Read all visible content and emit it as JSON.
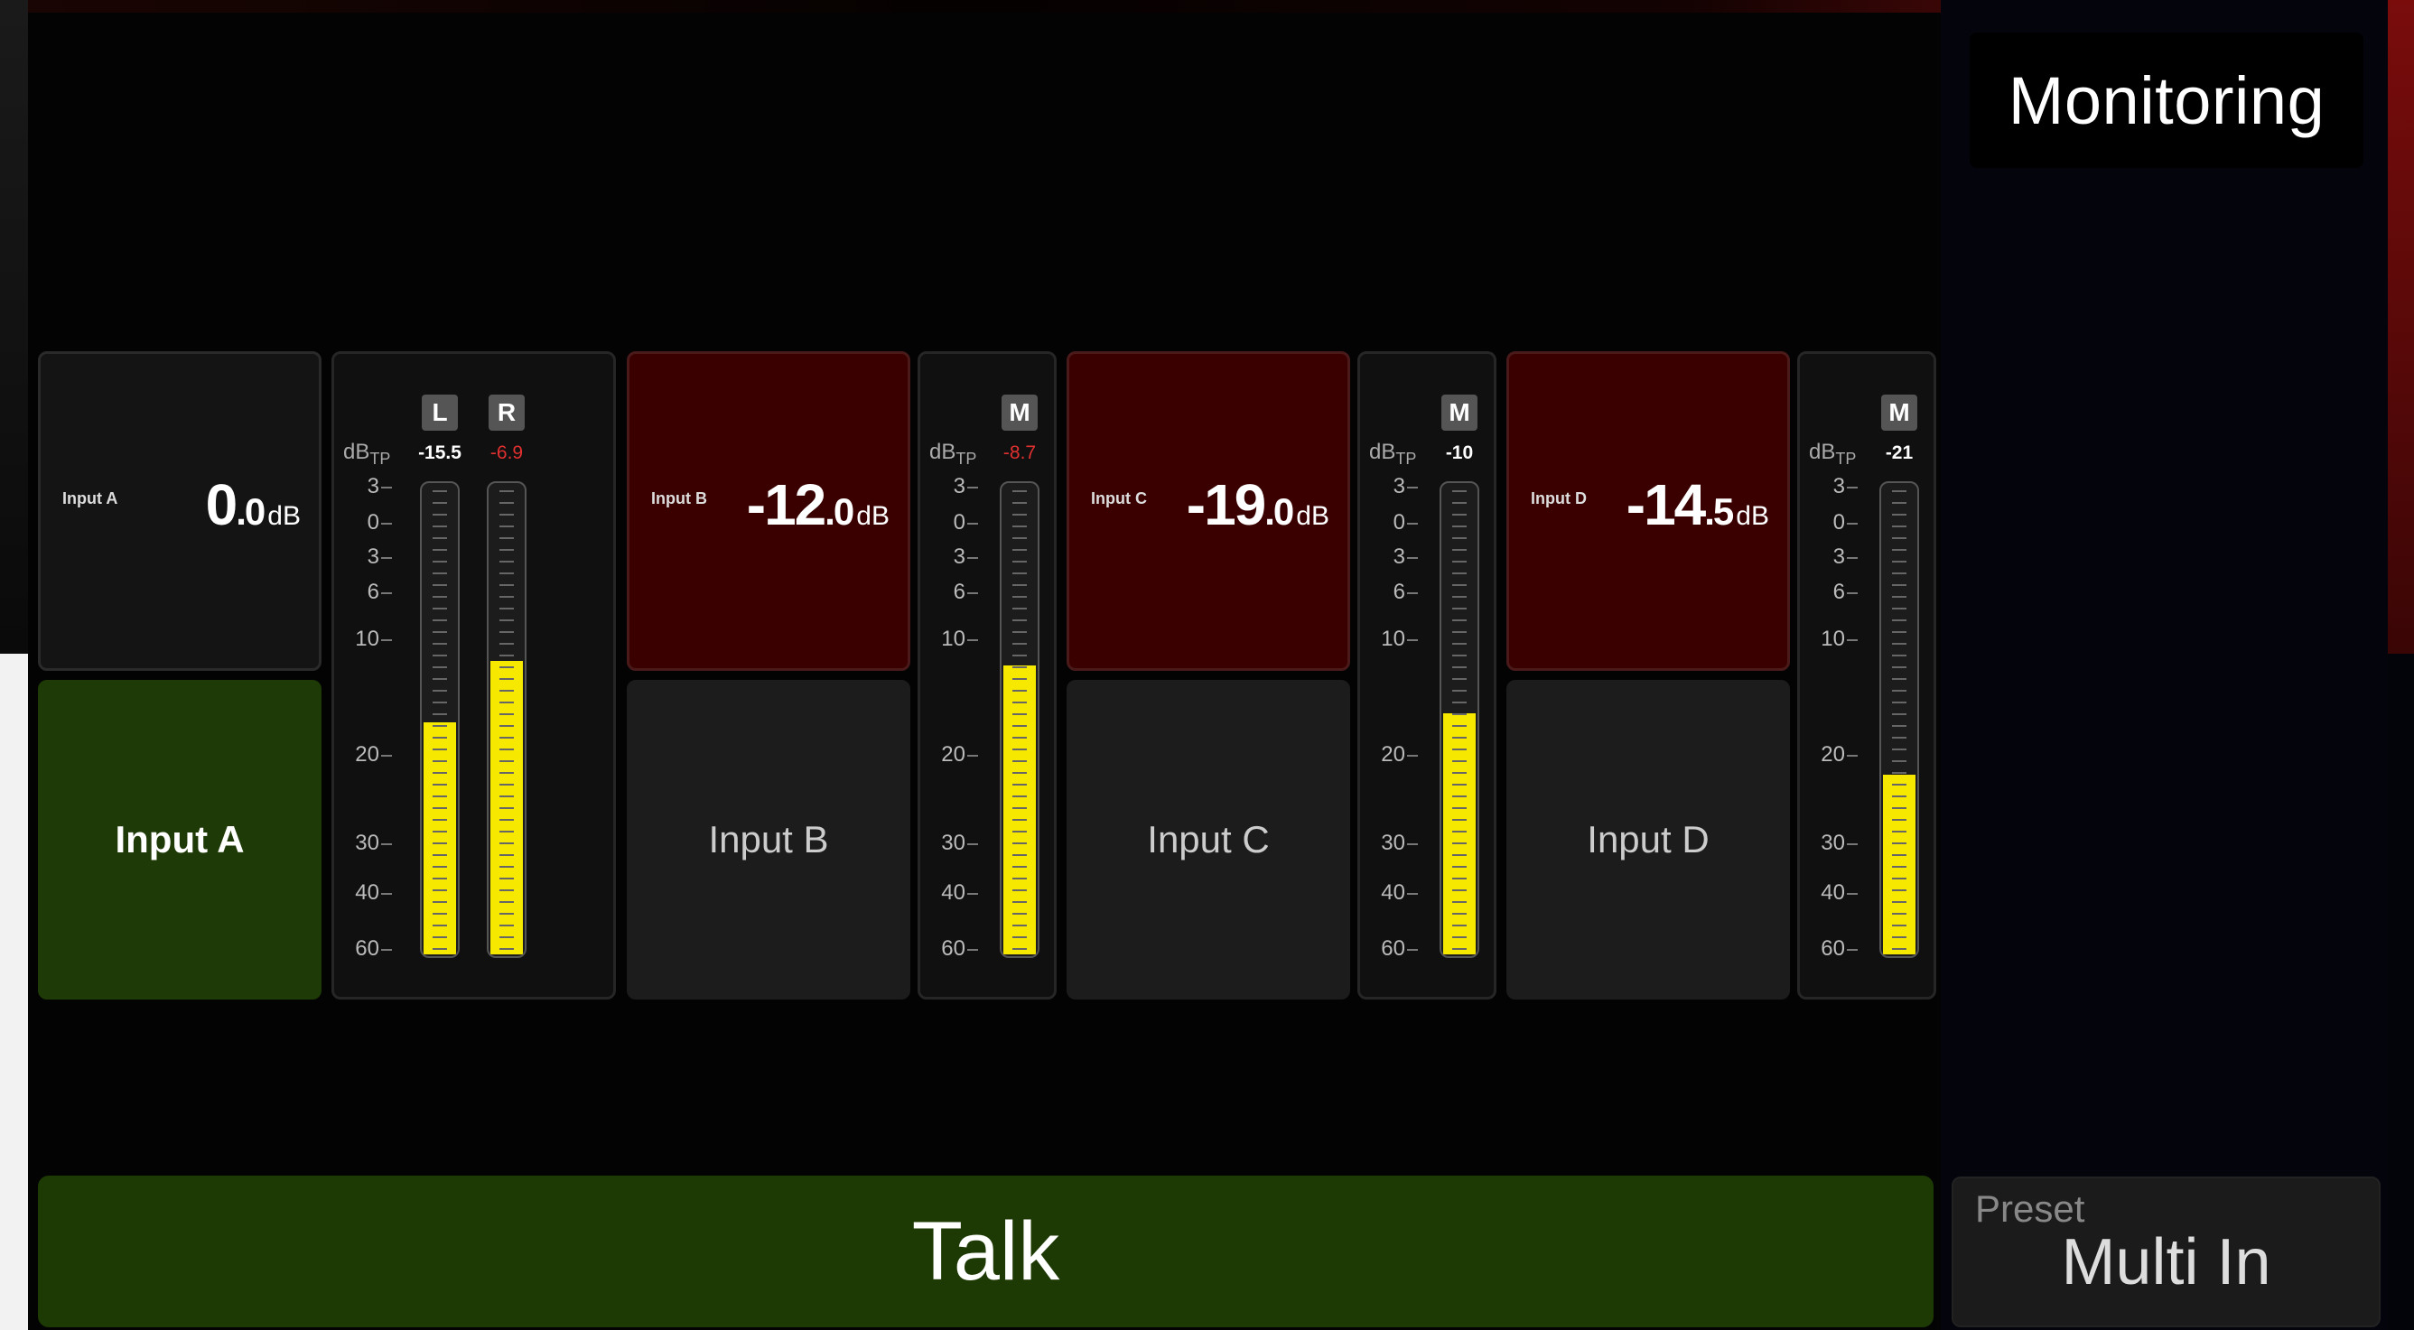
{
  "header": {
    "title": "Monitoring"
  },
  "meter_scale": {
    "unit": "dB",
    "sub": "TP",
    "ticks": [
      "3",
      "0",
      "3",
      "6",
      "10",
      "20",
      "30",
      "40",
      "60"
    ]
  },
  "channels": [
    {
      "name": "Input A",
      "gain_int": "0",
      "gain_dec": ".0",
      "gain_unit": "dB",
      "selected": true,
      "meter": [
        {
          "badge": "L",
          "peak": "-15.5",
          "hot": false,
          "level": 0.49
        },
        {
          "badge": "R",
          "peak": "-6.9",
          "hot": true,
          "level": 0.62
        }
      ]
    },
    {
      "name": "Input B",
      "gain_int": "-12",
      "gain_dec": ".0",
      "gain_unit": "dB",
      "selected": false,
      "meter": [
        {
          "badge": "M",
          "peak": "-8.7",
          "hot": true,
          "level": 0.61
        }
      ]
    },
    {
      "name": "Input C",
      "gain_int": "-19",
      "gain_dec": ".0",
      "gain_unit": "dB",
      "selected": false,
      "meter": [
        {
          "badge": "M",
          "peak": "-10",
          "hot": false,
          "level": 0.51
        }
      ]
    },
    {
      "name": "Input D",
      "gain_int": "-14",
      "gain_dec": ".5",
      "gain_unit": "dB",
      "selected": false,
      "meter": [
        {
          "badge": "M",
          "peak": "-21",
          "hot": false,
          "level": 0.38
        }
      ]
    }
  ],
  "talk": {
    "label": "Talk"
  },
  "preset": {
    "label": "Preset",
    "value": "Multi In"
  },
  "colors": {
    "active_green": "#1e3a06",
    "muted_red": "#3a0000",
    "meter_yellow": "#f7e800",
    "peak_hot": "#e03030"
  }
}
